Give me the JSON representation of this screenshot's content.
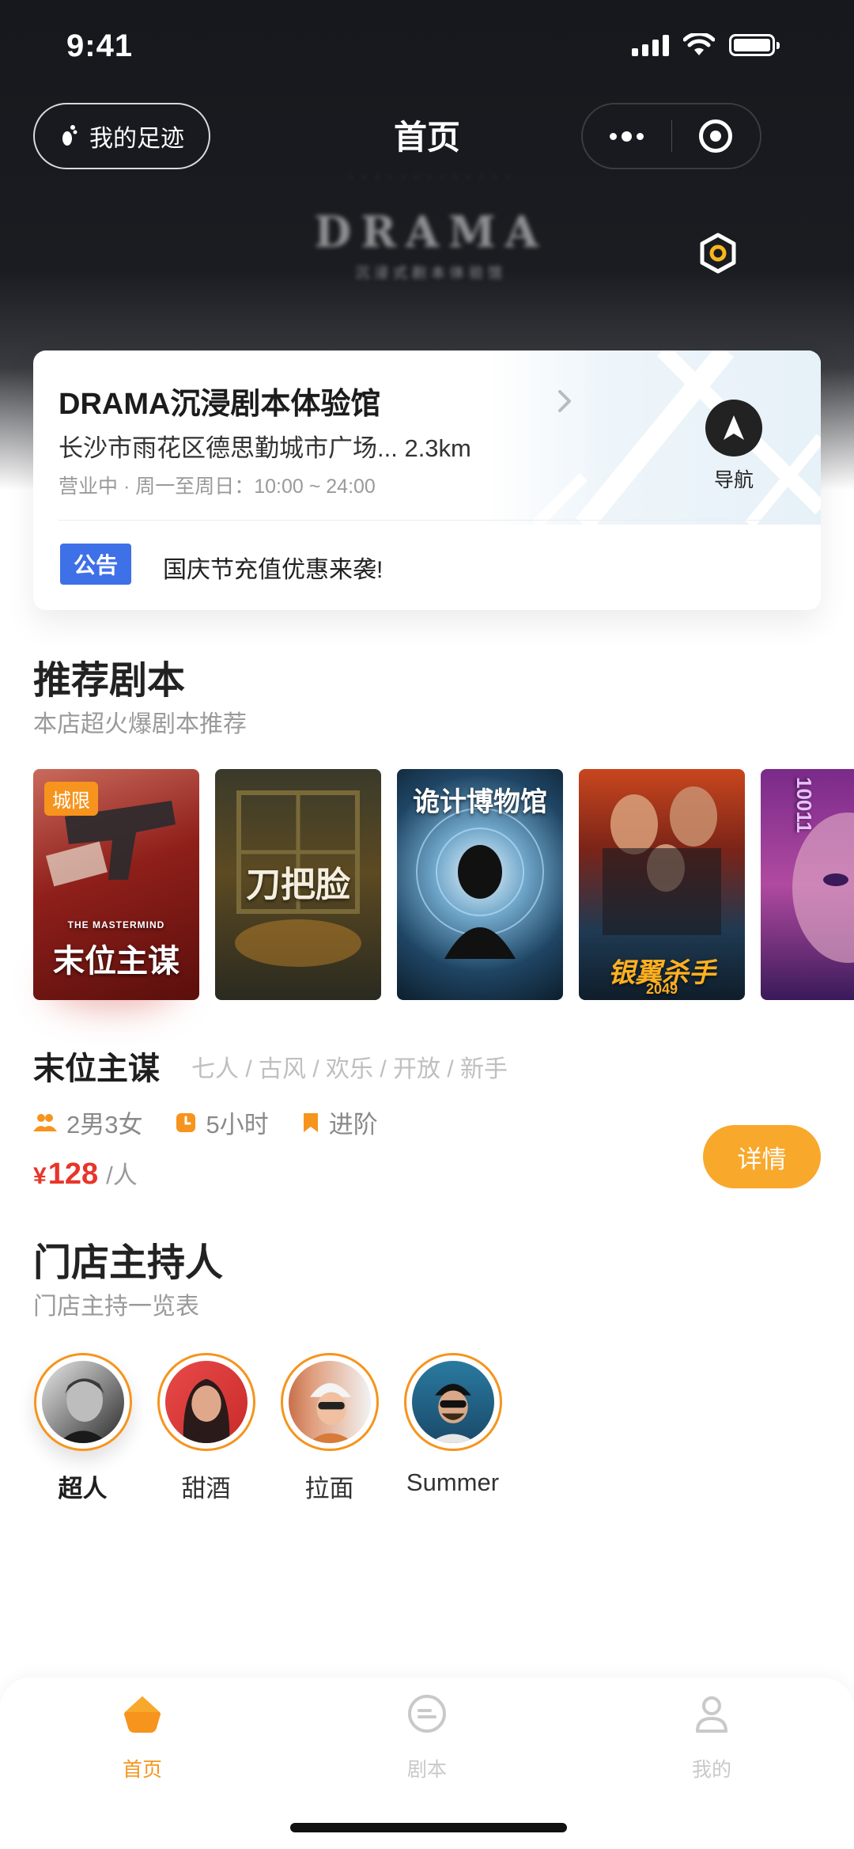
{
  "status_bar": {
    "time": "9:41"
  },
  "nav": {
    "footprint_label": "我的足迹",
    "title": "首页"
  },
  "store": {
    "name": "DRAMA沉浸剧本体验馆",
    "address": "长沙市雨花区德思勤城市广场... 2.3km",
    "hours": "营业中 · 周一至周日：10:00 ~ 24:00",
    "nav_label": "导航",
    "notice_badge": "公告",
    "notice_text": "国庆节充值优惠来袭!"
  },
  "recommend": {
    "title": "推荐剧本",
    "subtitle": "本店超火爆剧本推荐",
    "posters": [
      {
        "tag": "城限",
        "title": "末位主谋",
        "en": "THE MASTERMIND"
      },
      {
        "title": "刀把脸"
      },
      {
        "title": "诡计博物馆"
      },
      {
        "title": "银翼杀手",
        "en": "2049"
      },
      {
        "title": "10011"
      }
    ]
  },
  "script": {
    "name": "末位主谋",
    "tags": "七人 / 古风 / 欢乐 / 开放 / 新手",
    "players": "2男3女",
    "duration": "5小时",
    "level": "进阶",
    "price_symbol": "¥",
    "price": "128",
    "price_unit": "/人",
    "detail_label": "详情"
  },
  "hosts": {
    "title": "门店主持人",
    "subtitle": "门店主持一览表",
    "items": [
      {
        "name": "超人"
      },
      {
        "name": "甜酒"
      },
      {
        "name": "拉面"
      },
      {
        "name": "Summer"
      }
    ]
  },
  "tabbar": {
    "items": [
      {
        "label": "首页",
        "icon": "home-icon",
        "active": true
      },
      {
        "label": "剧本",
        "icon": "script-icon",
        "active": false
      },
      {
        "label": "我的",
        "icon": "profile-icon",
        "active": false
      }
    ]
  },
  "colors": {
    "accent": "#f6941d",
    "price": "#e8352a",
    "notice": "#3e70e8",
    "hero": "#16181d"
  }
}
